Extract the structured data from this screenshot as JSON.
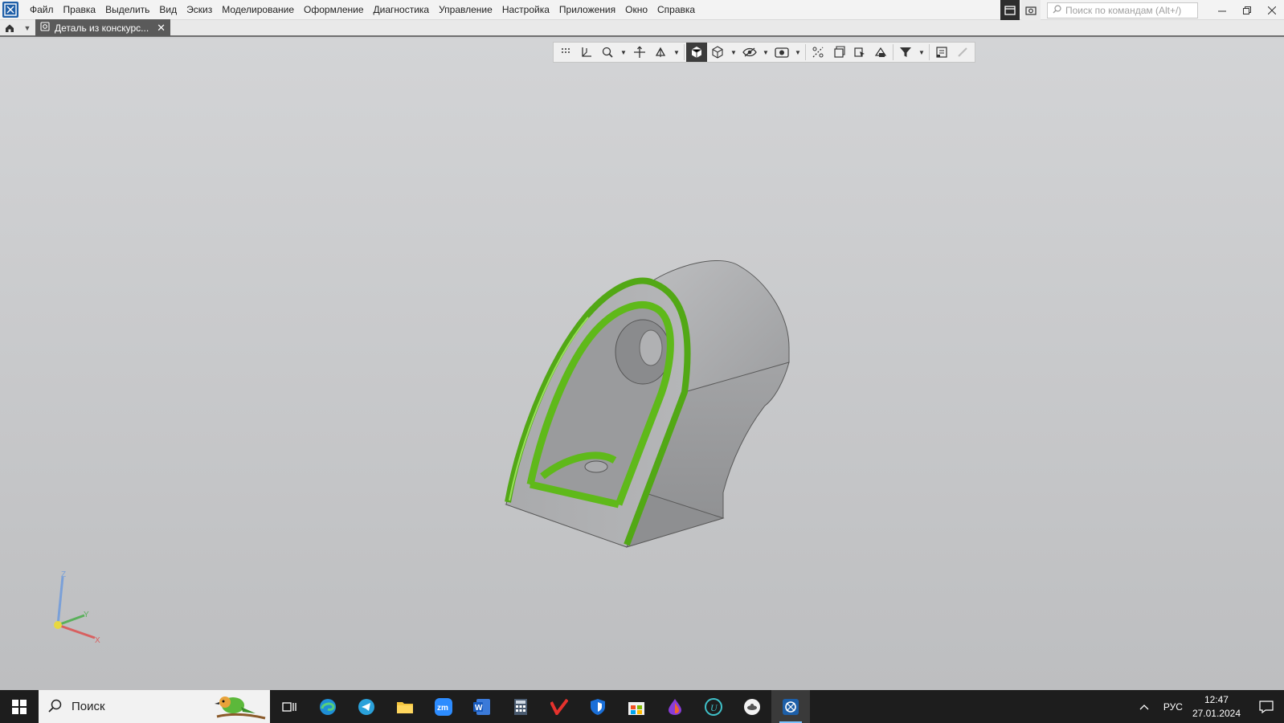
{
  "menu": {
    "items": [
      "Файл",
      "Правка",
      "Выделить",
      "Вид",
      "Эскиз",
      "Моделирование",
      "Оформление",
      "Диагностика",
      "Управление",
      "Настройка",
      "Приложения",
      "Окно",
      "Справка"
    ]
  },
  "search": {
    "placeholder": "Поиск по командам (Alt+/)"
  },
  "tab": {
    "label": "Деталь из конскурс...",
    "close": "✕"
  },
  "view_toolbar": {
    "icons": [
      "grid-icon",
      "orientation-icon",
      "zoom-icon",
      "pan-icon",
      "rotate-icon",
      "view-shaded-icon",
      "view-wireframe-icon",
      "hide-icon",
      "display-style-icon",
      "section-icon",
      "clip-icon",
      "render-icon",
      "filter-icon",
      "properties-icon",
      "measure-icon"
    ]
  },
  "triad": {
    "z": "Z",
    "y": "Y",
    "x": "X"
  },
  "taskbar": {
    "search_label": "Поиск",
    "apps": [
      "task-view-icon",
      "edge-icon",
      "telegram-icon",
      "explorer-icon",
      "zoom-icon",
      "word-icon",
      "calculator-icon",
      "app-v-icon",
      "defender-icon",
      "store-icon",
      "drop-icon",
      "u-app-icon",
      "disk-icon",
      "kompas-icon"
    ],
    "lang": "РУС",
    "time": "12:47",
    "date": "27.01.2024"
  },
  "colors": {
    "accent_green": "#5fb91a",
    "model_gray": "#a7a8aa",
    "taskbar": "#1d1d1d"
  }
}
